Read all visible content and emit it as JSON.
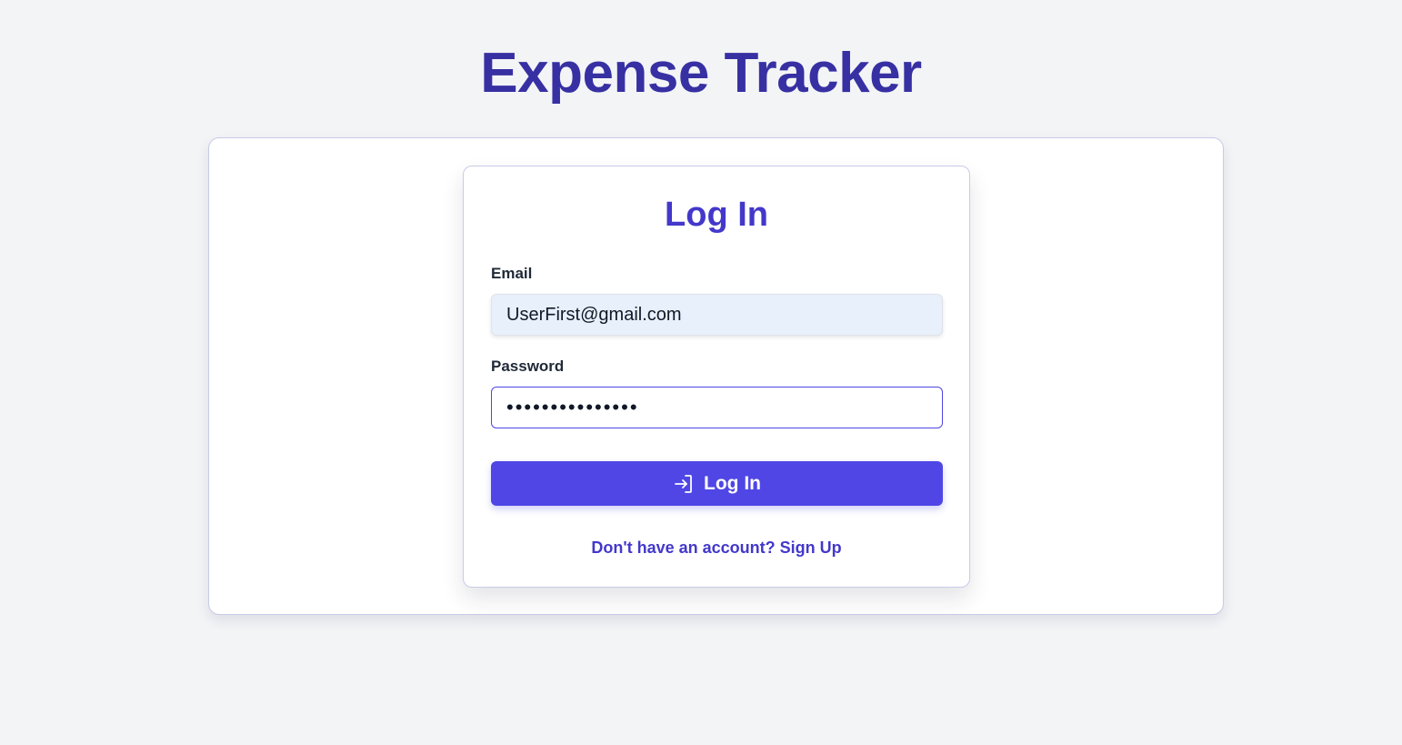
{
  "app": {
    "title": "Expense Tracker"
  },
  "login_form": {
    "heading": "Log In",
    "email": {
      "label": "Email",
      "value": "UserFirst@gmail.com"
    },
    "password": {
      "label": "Password",
      "value": "•••••••••••••••"
    },
    "submit": {
      "label": "Log In",
      "icon": "login-arrow-icon"
    },
    "signup_link": "Don't have an account? Sign Up"
  },
  "colors": {
    "background": "#f3f4f6",
    "title": "#3730a3",
    "accent": "#4f46e5",
    "heading": "#4338ca",
    "email_fill": "#e8f0fb"
  }
}
